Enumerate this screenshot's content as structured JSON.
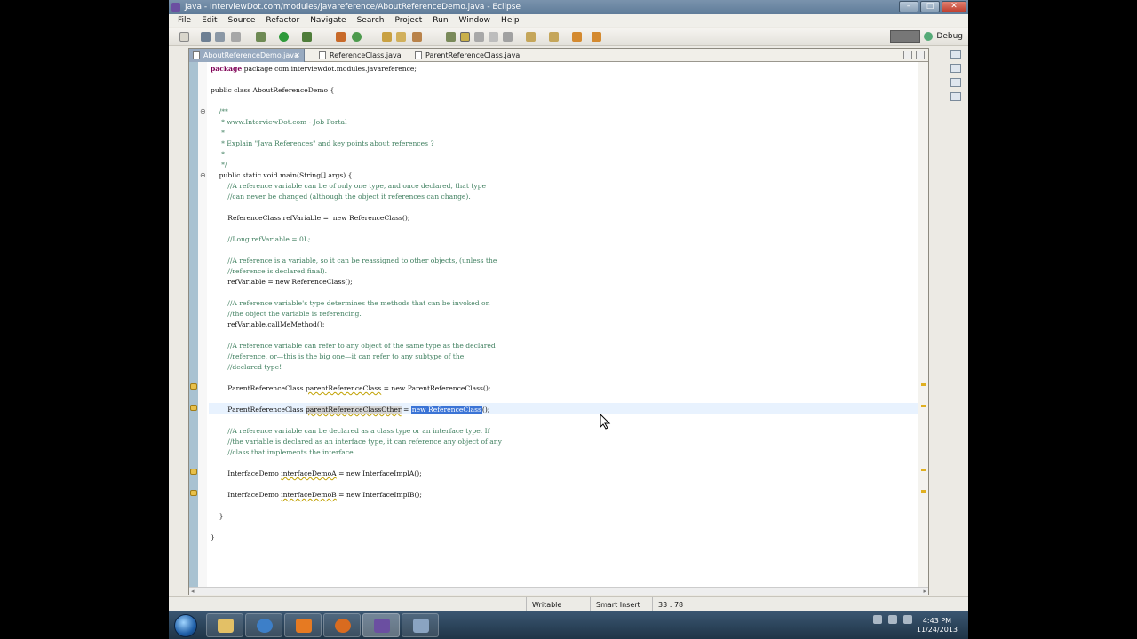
{
  "window": {
    "title": "Java - InterviewDot.com/modules/javareference/AboutReferenceDemo.java - Eclipse"
  },
  "menu": [
    "File",
    "Edit",
    "Source",
    "Refactor",
    "Navigate",
    "Search",
    "Project",
    "Run",
    "Window",
    "Help"
  ],
  "perspective": {
    "label": "Debug"
  },
  "tabs": [
    {
      "label": "AboutReferenceDemo.java"
    },
    {
      "label": "ReferenceClass.java"
    },
    {
      "label": "ParentReferenceClass.java"
    }
  ],
  "code": {
    "l1": "package com.interviewdot.modules.javareference;",
    "l3": "public class AboutReferenceDemo {",
    "l5": "    /**",
    "l6": "     * www.InterviewDot.com - Job Portal",
    "l7": "     *",
    "l8": "     * Explain \"Java References\" and key points about references ?",
    "l9": "     *",
    "l10": "     */",
    "l11": "    public static void main(String[] args) {",
    "l12": "        //A reference variable can be of only one type, and once declared, that type",
    "l13": "        //can never be changed (although the object it references can change).",
    "l15": "        ReferenceClass refVariable =  new ReferenceClass();",
    "l17": "        //Long refVariable = 0L;",
    "l19": "        //A reference is a variable, so it can be reassigned to other objects, (unless the",
    "l20": "        //reference is declared final).",
    "l21": "        refVariable = new ReferenceClass();",
    "l23": "        //A reference variable's type determines the methods that can be invoked on",
    "l24": "        //the object the variable is referencing.",
    "l25": "        refVariable.callMeMethod();",
    "l27": "        //A reference variable can refer to any object of the same type as the declared",
    "l28": "        //reference, or—this is the big one—it can refer to any subtype of the",
    "l29": "        //declared type!",
    "l31a": "        ParentReferenceClass ",
    "l31b": "parentReferenceClass",
    "l31c": " = new ParentReferenceClass();",
    "l33a": "        ParentReferenceClass ",
    "l33b": "parentReferenceClassOther",
    "l33c": " = ",
    "l33d": "new ReferenceClass",
    "l33e": "();",
    "l35": "        //A reference variable can be declared as a class type or an interface type. If",
    "l36": "        //the variable is declared as an interface type, it can reference any object of any",
    "l37": "        //class that implements the interface.",
    "l39a": "        InterfaceDemo ",
    "l39b": "interfaceDemoA",
    "l39c": " = new InterfaceImplA();",
    "l41a": "        InterfaceDemo ",
    "l41b": "interfaceDemoB",
    "l41c": " = new InterfaceImplB();",
    "l43": "    }",
    "l45": "}"
  },
  "status": {
    "writable": "Writable",
    "insert_mode": "Smart Insert",
    "position": "33 : 78"
  },
  "taskbar": {
    "time": "4:43 PM",
    "date": "11/24/2013"
  }
}
